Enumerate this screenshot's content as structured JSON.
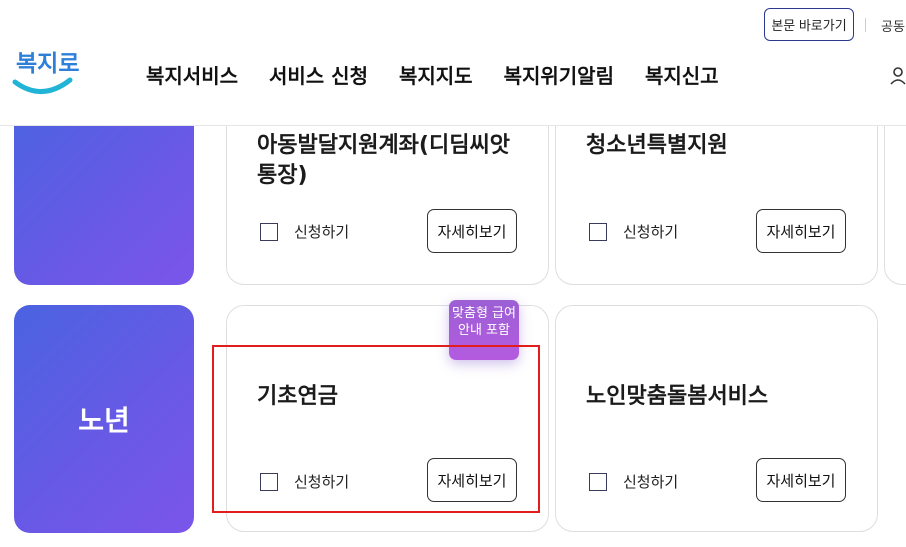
{
  "header": {
    "skip_link": "본문 바로가기",
    "util_link": "공동",
    "logo_text": "복지로",
    "nav": [
      "복지서비스",
      "서비스 신청",
      "복지지도",
      "복지위기알림",
      "복지신고"
    ]
  },
  "rows": [
    {
      "category": "",
      "cards": [
        {
          "title": "아동발달지원계좌(디딤씨앗통장)",
          "apply_label": "신청하기",
          "detail_label": "자세히보기"
        },
        {
          "title": "청소년특별지원",
          "apply_label": "신청하기",
          "detail_label": "자세히보기"
        }
      ]
    },
    {
      "category": "노년",
      "cards": [
        {
          "title": "기초연금",
          "apply_label": "신청하기",
          "detail_label": "자세히보기",
          "badge": "맞춤형 급여안내 포함"
        },
        {
          "title": "노인맞춤돌봄서비스",
          "apply_label": "신청하기",
          "detail_label": "자세히보기"
        }
      ]
    }
  ],
  "colors": {
    "accent": "#5a5fe3",
    "highlight": "#e11d1d",
    "badge": "#a85ddb"
  }
}
